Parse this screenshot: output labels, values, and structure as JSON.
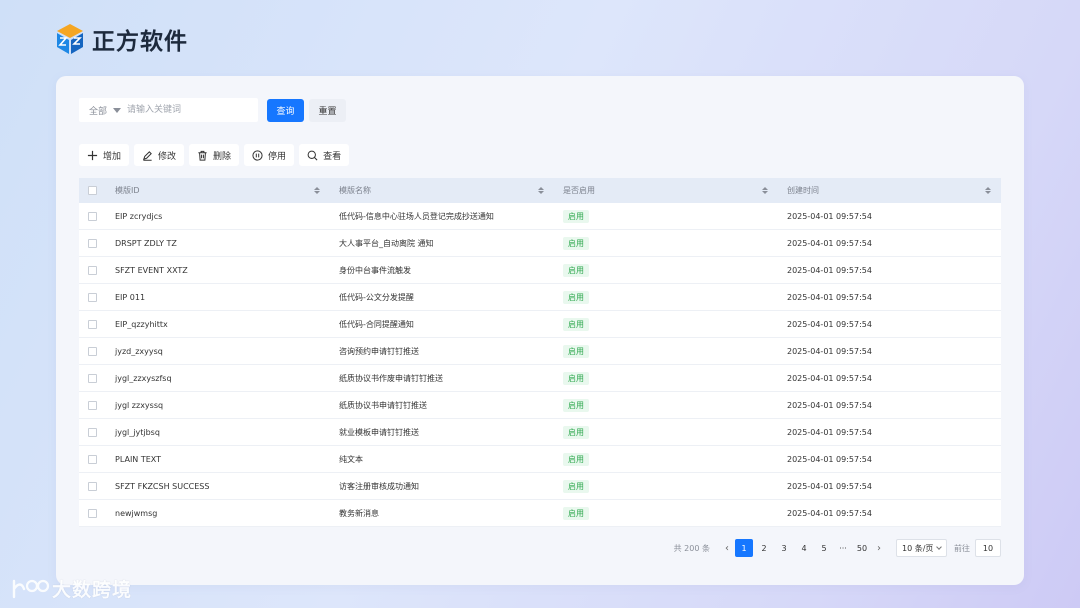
{
  "brand": {
    "name": "正方软件",
    "logo_icon": "cube-logo-icon",
    "colors": {
      "blue": "#1e88e5",
      "orange": "#f5a623"
    }
  },
  "search": {
    "scope": "全部",
    "placeholder": "请输入关键词",
    "query_label": "查询",
    "reset_label": "重置"
  },
  "toolbar": [
    {
      "label": "增加",
      "icon": "plus-icon"
    },
    {
      "label": "修改",
      "icon": "edit-icon"
    },
    {
      "label": "删除",
      "icon": "trash-icon"
    },
    {
      "label": "停用",
      "icon": "pause-circle-icon"
    },
    {
      "label": "查看",
      "icon": "search-icon"
    }
  ],
  "table": {
    "columns": [
      "模版ID",
      "模版名称",
      "是否启用",
      "创建时间"
    ],
    "rows": [
      {
        "id": "EIP zcrydjcs",
        "name": "低代码-信息中心驻场人员登记完成抄送通知",
        "status": "启用",
        "created": "2025-04-01 09:57:54"
      },
      {
        "id": "DRSPT ZDLY TZ",
        "name": "大人事平台_自动离院 通知",
        "status": "启用",
        "created": "2025-04-01 09:57:54"
      },
      {
        "id": "SFZT EVENT XXTZ",
        "name": "身份中台事件流触发",
        "status": "启用",
        "created": "2025-04-01 09:57:54"
      },
      {
        "id": "EIP 011",
        "name": "低代码-公文分发提醒",
        "status": "启用",
        "created": "2025-04-01 09:57:54"
      },
      {
        "id": "EIP_qzzyhittx",
        "name": "低代码-合同提醒通知",
        "status": "启用",
        "created": "2025-04-01 09:57:54"
      },
      {
        "id": "jyzd_zxyysq",
        "name": "咨询预约申请钉钉推送",
        "status": "启用",
        "created": "2025-04-01 09:57:54"
      },
      {
        "id": "jygl_zzxyszfsq",
        "name": "纸质协议书作废申请钉钉推送",
        "status": "启用",
        "created": "2025-04-01 09:57:54"
      },
      {
        "id": "jygl zzxyssq",
        "name": "纸质协议书申请钉钉推送",
        "status": "启用",
        "created": "2025-04-01 09:57:54"
      },
      {
        "id": "jygl_jytjbsq",
        "name": "就业模板申请钉钉推送",
        "status": "启用",
        "created": "2025-04-01 09:57:54"
      },
      {
        "id": "PLAIN TEXT",
        "name": "纯文本",
        "status": "启用",
        "created": "2025-04-01 09:57:54"
      },
      {
        "id": "SFZT FKZCSH SUCCESS",
        "name": "访客注册审核成功通知",
        "status": "启用",
        "created": "2025-04-01 09:57:54"
      },
      {
        "id": "newjwmsg",
        "name": "教务新消息",
        "status": "启用",
        "created": "2025-04-01 09:57:54"
      }
    ]
  },
  "pagination": {
    "total_text": "共 200 条",
    "pages": [
      "1",
      "2",
      "3",
      "4",
      "5",
      "···",
      "50"
    ],
    "current_page": "1",
    "page_size": "10 条/页",
    "goto_label": "前往",
    "goto_value": "10"
  },
  "watermark": {
    "text": "大数跨境"
  },
  "colors": {
    "primary": "#1677ff",
    "status_green": "#2fa84f",
    "status_bg": "#e9f8ee"
  }
}
